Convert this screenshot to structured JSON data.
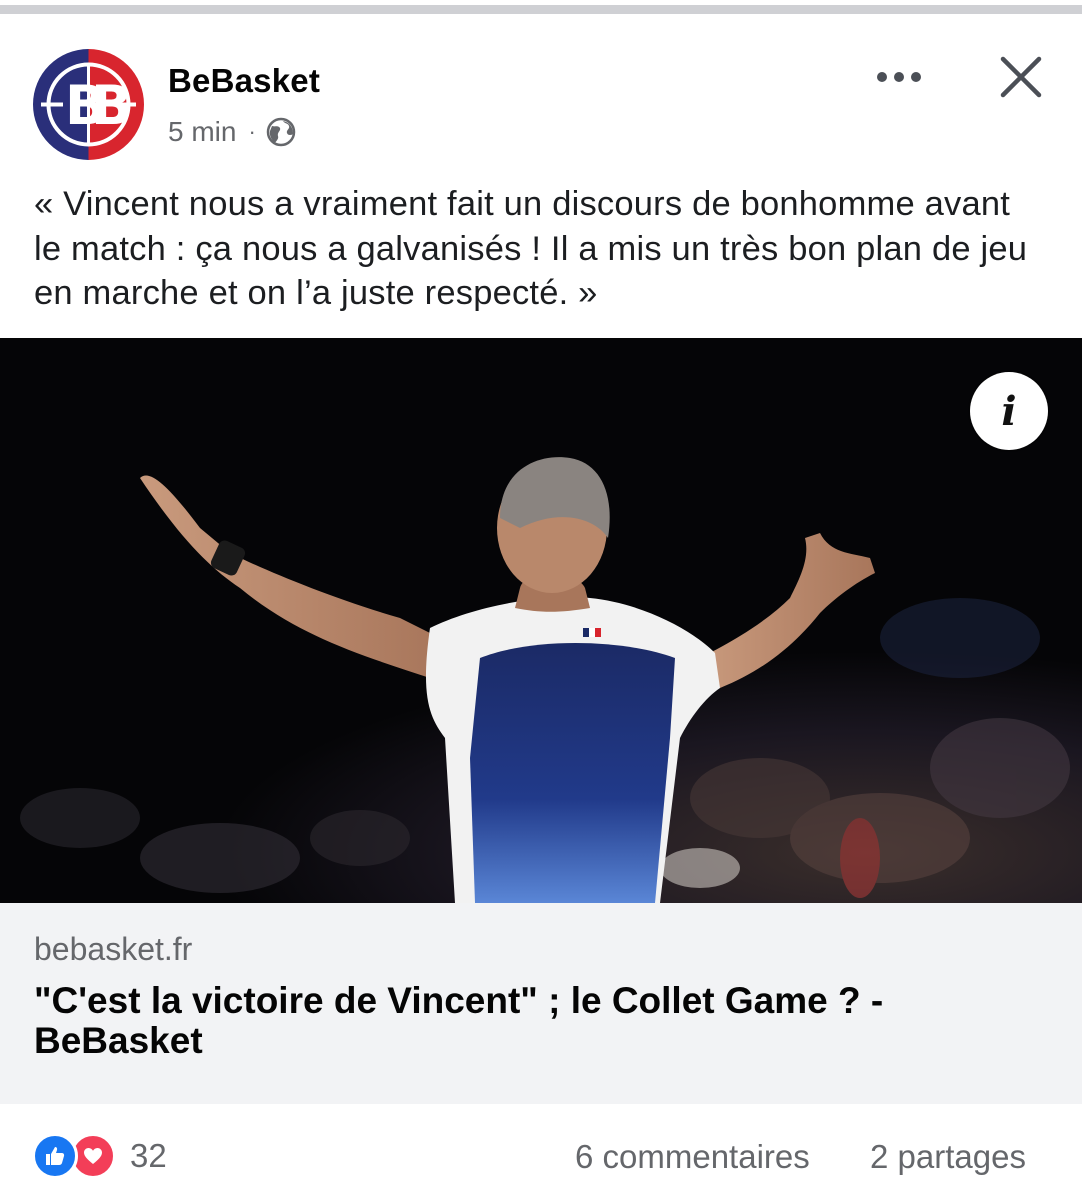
{
  "post": {
    "page_name": "BeBasket",
    "time": "5 min",
    "separator": "·",
    "audience_icon": "globe-icon",
    "avatar_letters": "BB",
    "text": "« Vincent nous a vraiment fait un discours de bonhomme avant le match : ça nous a galvanisés ! Il a mis un très bon plan de jeu en marche et on l’a juste respecté. »"
  },
  "header_actions": {
    "more_icon": "more-horizontal-icon",
    "close_icon": "close-icon"
  },
  "photo": {
    "info_label": "i"
  },
  "link_preview": {
    "domain": "bebasket.fr",
    "title": "\"C'est la victoire de Vincent\" ; le Collet Game ? - BeBasket"
  },
  "engagement": {
    "reaction_icons": [
      "like-icon",
      "love-icon"
    ],
    "reaction_count": "32",
    "comments": "6 commentaires",
    "shares": "2 partages"
  },
  "colors": {
    "brand_blue": "#1877f2",
    "love_red": "#f33e58",
    "secondary_text": "#65676b",
    "card_bg": "#f2f3f5",
    "avatar_blue": "#2a2f7a",
    "avatar_red": "#d8252e"
  }
}
